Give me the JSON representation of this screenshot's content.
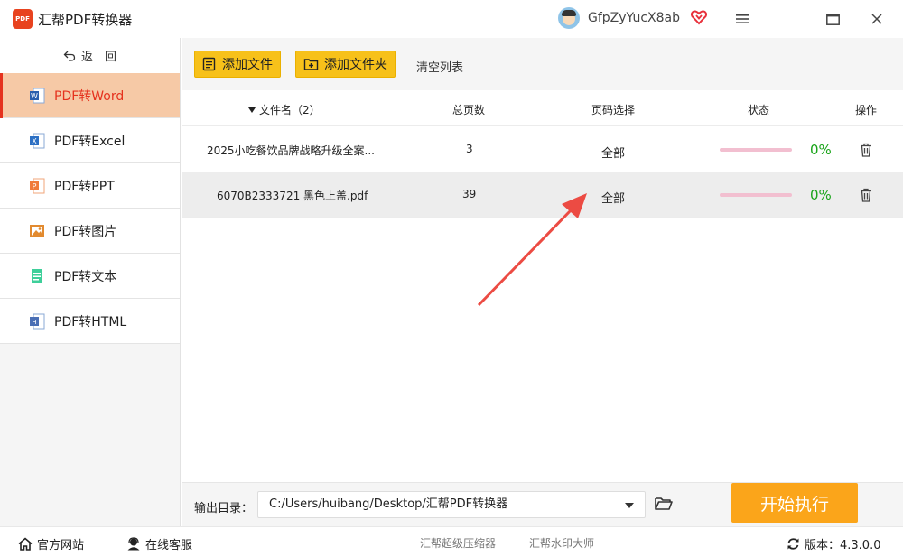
{
  "app": {
    "title": "汇帮PDF转换器",
    "logo_text": "PDF"
  },
  "user": {
    "name": "GfpZyYucX8ab"
  },
  "sidebar": {
    "back_label": "返　回",
    "items": [
      {
        "label": "PDF转Word",
        "icon": "word-icon",
        "active": true
      },
      {
        "label": "PDF转Excel",
        "icon": "excel-icon",
        "active": false
      },
      {
        "label": "PDF转PPT",
        "icon": "ppt-icon",
        "active": false
      },
      {
        "label": "PDF转图片",
        "icon": "image-icon",
        "active": false
      },
      {
        "label": "PDF转文本",
        "icon": "text-icon",
        "active": false
      },
      {
        "label": "PDF转HTML",
        "icon": "html-icon",
        "active": false
      }
    ]
  },
  "toolbar": {
    "add_file": "添加文件",
    "add_folder": "添加文件夹",
    "clear_list": "清空列表"
  },
  "table": {
    "headers": {
      "filename": "文件名（2）",
      "pages": "总页数",
      "page_select": "页码选择",
      "status": "状态",
      "action": "操作"
    },
    "rows": [
      {
        "filename": "2025小吃餐饮品牌战略升级全案...",
        "pages": "3",
        "page_select": "全部",
        "progress": "0%"
      },
      {
        "filename": "6070B2333721 黑色上盖.pdf",
        "pages": "39",
        "page_select": "全部",
        "progress": "0%"
      }
    ]
  },
  "output": {
    "label": "输出目录：",
    "path": "C:/Users/huibang/Desktop/汇帮PDF转换器"
  },
  "start_button": "开始执行",
  "footer": {
    "website": "官方网站",
    "support": "在线客服",
    "link1": "汇帮超级压缩器",
    "link2": "汇帮水印大师",
    "version": "版本：4.3.0.0"
  },
  "colors": {
    "accent": "#f7c11a",
    "active_nav": "#f6c9a6",
    "active_text": "#e5321e",
    "start": "#fba51a",
    "progress_text": "#1aa41a",
    "arrow": "#ec4b43"
  }
}
